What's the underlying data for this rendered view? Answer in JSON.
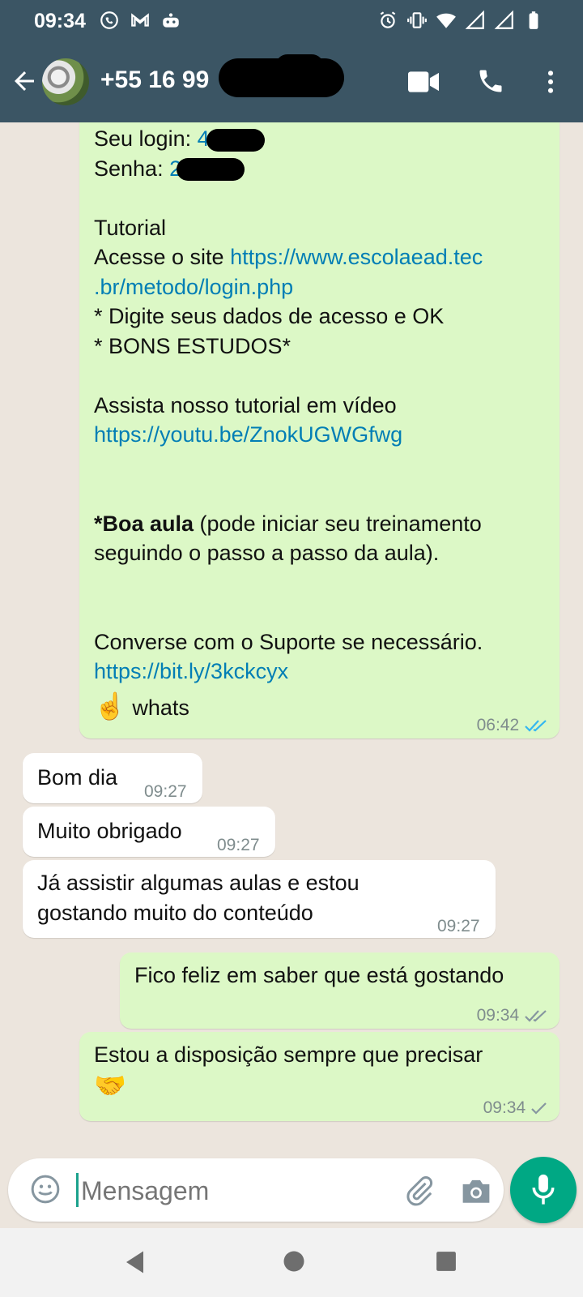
{
  "status_bar": {
    "time": "09:34",
    "left_icons": [
      "whatsapp-icon",
      "gmail-icon",
      "assistant-icon"
    ],
    "right_icons": [
      "alarm-icon",
      "vibrate-icon",
      "wifi-icon",
      "signal-icon",
      "signal-icon",
      "battery-icon"
    ]
  },
  "header": {
    "contact_name": "+55 16 99",
    "icons": [
      "back-arrow-icon",
      "video-call-icon",
      "voice-call-icon",
      "more-options-icon"
    ]
  },
  "messages": [
    {
      "direction": "outgoing",
      "lines": [
        {
          "parts": [
            {
              "text": "Seu login: "
            },
            {
              "text": "4",
              "link": true
            }
          ]
        },
        {
          "parts": [
            {
              "text": "Senha: "
            },
            {
              "text": "2",
              "link": true
            }
          ]
        },
        {
          "parts": []
        },
        {
          "parts": [
            {
              "text": "Tutorial"
            }
          ]
        },
        {
          "parts": [
            {
              "text": "Acesse o site "
            },
            {
              "text": "https://www.escolaead.tec",
              "link": true
            }
          ]
        },
        {
          "parts": [
            {
              "text": ".br/metodo/login.php",
              "link": true
            }
          ]
        },
        {
          "parts": [
            {
              "text": "* Digite seus dados de acesso e OK"
            }
          ]
        },
        {
          "parts": [
            {
              "text": "* BONS ESTUDOS*"
            }
          ]
        },
        {
          "parts": []
        },
        {
          "parts": [
            {
              "text": "Assista nosso tutorial em vídeo"
            }
          ]
        },
        {
          "parts": [
            {
              "text": "https://youtu.be/ZnokUGWGfwg",
              "link": true
            }
          ]
        },
        {
          "parts": []
        },
        {
          "parts": []
        },
        {
          "parts": [
            {
              "text": "*Boa aula",
              "bold": true
            },
            {
              "text": " (pode iniciar seu treinamento"
            }
          ]
        },
        {
          "parts": [
            {
              "text": "seguindo o passo a passo da aula)."
            }
          ]
        },
        {
          "parts": []
        },
        {
          "parts": []
        },
        {
          "parts": [
            {
              "text": "Converse com o Suporte se necessário."
            }
          ]
        },
        {
          "parts": [
            {
              "text": "https://bit.ly/3kckcyx",
              "link": true
            }
          ]
        },
        {
          "parts": [
            {
              "text": "☝️"
            },
            {
              "text": " whats"
            }
          ]
        }
      ],
      "time": "06:42",
      "status": "read"
    },
    {
      "direction": "incoming",
      "text": "Bom dia",
      "time": "09:27"
    },
    {
      "direction": "incoming",
      "text": "Muito obrigado",
      "time": "09:27"
    },
    {
      "direction": "incoming",
      "text_lines": [
        "Já assistir algumas aulas e estou",
        "gostando muito do conteúdo"
      ],
      "time": "09:27"
    },
    {
      "direction": "outgoing",
      "text": "Fico feliz em saber que está gostando",
      "time": "09:34",
      "status": "delivered"
    },
    {
      "direction": "outgoing",
      "text": "Estou a disposição sempre que precisar",
      "emoji": "🤝",
      "time": "09:34",
      "status": "sent"
    }
  ],
  "composer": {
    "placeholder": "Mensagem",
    "icons": [
      "emoji-icon",
      "attach-icon",
      "camera-icon",
      "mic-icon"
    ]
  },
  "nav_bar": {
    "icons": [
      "nav-back-icon",
      "nav-home-icon",
      "nav-recent-icon"
    ]
  },
  "colors": {
    "header_bg": "#3b5564",
    "chat_bg": "#ece5dd",
    "outgoing_bubble": "#dcf8c6",
    "incoming_bubble": "#ffffff",
    "link": "#027eb5",
    "read_tick": "#34b7f1",
    "accent": "#00a884"
  }
}
